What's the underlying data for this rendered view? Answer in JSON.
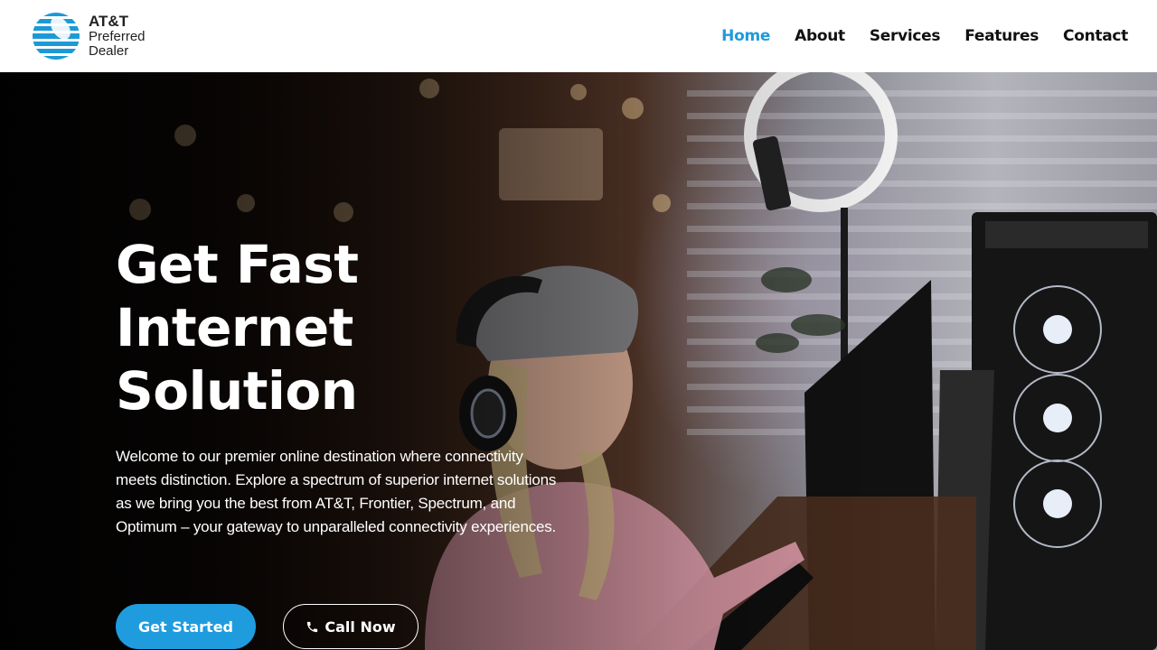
{
  "header": {
    "logo": {
      "line1": "AT&T",
      "line2": "Preferred",
      "line3": "Dealer",
      "icon": "att-globe-icon"
    },
    "nav": [
      {
        "label": "Home",
        "active": true
      },
      {
        "label": "About",
        "active": false
      },
      {
        "label": "Services",
        "active": false
      },
      {
        "label": "Features",
        "active": false
      },
      {
        "label": "Contact",
        "active": false
      }
    ]
  },
  "hero": {
    "title_lines": [
      "Get Fast",
      "Internet",
      "Solution"
    ],
    "description": "Welcome to our premier online destination where connectivity meets distinction. Explore a spectrum of superior internet solutions as we bring you the best from AT&T, Frontier, Spectrum, and Optimum – your gateway to unparalleled connectivity experiences.",
    "buttons": {
      "primary_label": "Get Started",
      "secondary_label": "Call Now",
      "secondary_icon": "phone-icon"
    }
  },
  "colors": {
    "accent": "#1e9cde",
    "nav_active": "#1f9bdc",
    "text_dark": "#111111",
    "hero_text": "#ffffff"
  }
}
